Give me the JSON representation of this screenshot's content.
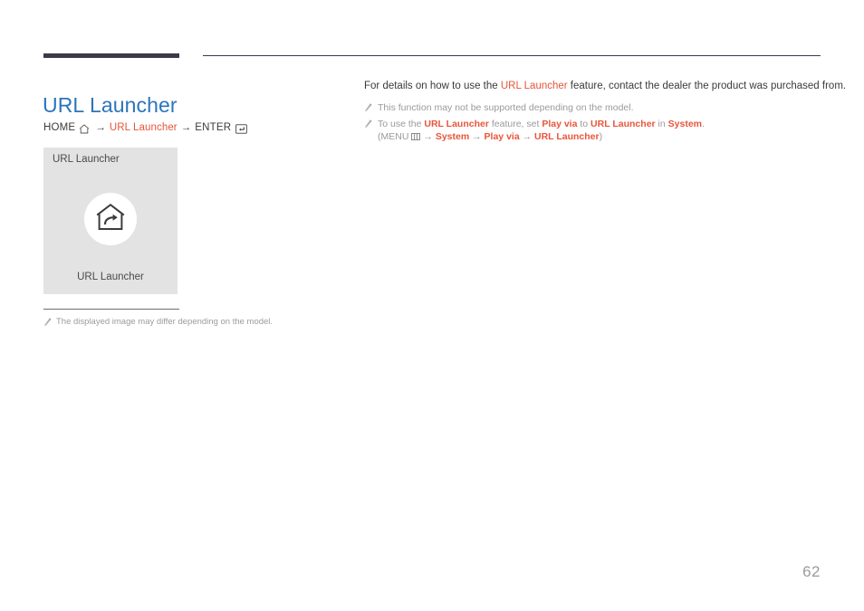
{
  "header": {
    "rule_color": "#3b3a48"
  },
  "page_title": "URL Launcher",
  "breadcrumb": {
    "home_label": "HOME",
    "home_icon": "home-icon",
    "arrow1": "→",
    "menu_label": "URL Launcher",
    "arrow2": "→",
    "enter_label": "ENTER",
    "enter_icon": "enter-key-icon"
  },
  "preview": {
    "top_label": "URL Launcher",
    "tile_icon": "home-arrow-icon",
    "bottom_label": "URL Launcher",
    "background_color": "#e3e3e3"
  },
  "figure_note": {
    "icon": "pencil-icon",
    "text": "The displayed image may differ depending on the model."
  },
  "content": {
    "lead": {
      "part1": "For details on how to use the ",
      "accent1": "URL Launcher",
      "part2": " feature, contact the dealer the product was purchased from."
    },
    "notes": [
      {
        "icon": "pencil-icon",
        "line1": "This function may not be supported depending on the model."
      },
      {
        "icon": "pencil-icon",
        "l2_p1": "To use the ",
        "l2_a1": "URL Launcher",
        "l2_p2": " feature, set ",
        "l2_a2": "Play via",
        "l2_p3": " to ",
        "l2_a3": "URL Launcher",
        "l2_p4": " in ",
        "l2_a4": "System",
        "l2_p5": ".",
        "path_open": "(MENU",
        "path_icon": "menu-grid-icon",
        "path_arrow1": "→",
        "path_a1": "System",
        "path_arrow2": "→",
        "path_a2": "Play via",
        "path_arrow3": "→",
        "path_a3": "URL Launcher",
        "path_close": ")"
      }
    ]
  },
  "page_number": "62",
  "colors": {
    "title_blue": "#2b75bb",
    "accent_orange": "#e8553a",
    "note_gray": "#9a9a9a",
    "rule_dark": "#3b3a48"
  }
}
